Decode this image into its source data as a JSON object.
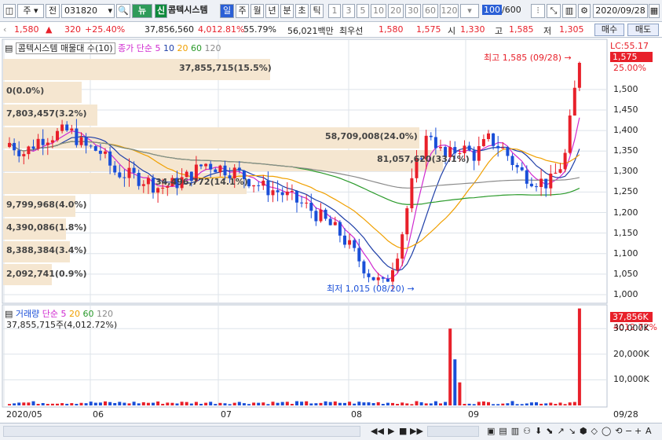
{
  "toolbar": {
    "market": "주",
    "prev": "전",
    "code": "031820",
    "badge": "뉴",
    "credit": "신",
    "name": "콤텍시스템",
    "periods": [
      "일",
      "주",
      "월",
      "년",
      "분",
      "초",
      "틱"
    ],
    "nums": [
      "1",
      "3",
      "5",
      "10",
      "20",
      "30",
      "60",
      "120"
    ],
    "count": "100",
    "total": "/600",
    "date": "2020/09/28"
  },
  "quote": {
    "price": "1,580",
    "change": "320",
    "rate": "+25.40%",
    "volume": "37,856,560",
    "vol_rate": "4,012.81%",
    "ratio": "55.79%",
    "amount": "56,021백만",
    "prio_label": "최우선",
    "ask": "1,580",
    "bid": "1,575",
    "open_label": "시",
    "open": "1,330",
    "high_label": "고",
    "high": "1,585",
    "low_label": "저",
    "low": "1,305",
    "buy": "매수",
    "sell": "매도"
  },
  "price_panel": {
    "legend": "콤텍시스템 매물대 수(10)",
    "legend2": "종가 단순",
    "ma": [
      "5",
      "10",
      "20",
      "60",
      "120"
    ],
    "lc": "LC:55.17",
    "cur_price": "1,575",
    "cur_pct": "25.00%",
    "high_mark": "최고 1,585 (09/28)",
    "low_mark": "최저 1,015 (08/20)",
    "profile_labels": [
      "37,855,715(15.5%)",
      "0(0.0%)",
      "7,803,457(3.2%)",
      "58,709,008(24.0%)",
      "81,057,620(33.1%)",
      "34,496,772(14.1%)",
      "9,799,968(4.0%)",
      "4,390,086(1.8%)",
      "8,388,384(3.4%)",
      "2,092,741(0.9%)"
    ],
    "yticks": [
      "1,500",
      "1,450",
      "1,400",
      "1,350",
      "1,300",
      "1,250",
      "1,200",
      "1,150",
      "1,100",
      "1,050",
      "1,000"
    ]
  },
  "volume_panel": {
    "legend": "거래량",
    "legend2": "단순",
    "ma": [
      "5",
      "20",
      "60",
      "120"
    ],
    "info": "37,855,715주(4,012.72%)",
    "cur": "37,856K",
    "cur_pct": "4012.72%",
    "yticks": [
      "30,000K",
      "20,000K",
      "10,000K"
    ]
  },
  "xaxis": [
    "2020/05",
    "06",
    "07",
    "08",
    "09"
  ],
  "axis_end": "09/28",
  "colors": {
    "up": "#e8202a",
    "down": "#1a4fd8",
    "ma5": "#d02ad0",
    "ma10": "#1f3fa8",
    "ma20": "#f0a000",
    "ma60": "#2a9a2a",
    "ma120": "#8a8a8a",
    "profile": "#f5e6d0"
  },
  "chart_data": {
    "type": "candlestick",
    "high": {
      "date": "09/28",
      "value": 1585
    },
    "low": {
      "date": "08/20",
      "value": 1015
    },
    "ylim": [
      980,
      1600
    ],
    "profile": [
      {
        "label": "37,855,715(15.5%)"
      },
      {
        "label": "0(0.0%)"
      },
      {
        "label": "7,803,457(3.2%)"
      },
      {
        "label": "58,709,008(24.0%)"
      },
      {
        "label": "81,057,620(33.1%)"
      },
      {
        "label": "34,496,772(14.1%)"
      },
      {
        "label": "9,799,968(4.0%)"
      },
      {
        "label": "4,390,086(1.8%)"
      },
      {
        "label": "8,388,384(3.4%)"
      },
      {
        "label": "2,092,741(0.9%)"
      }
    ]
  }
}
